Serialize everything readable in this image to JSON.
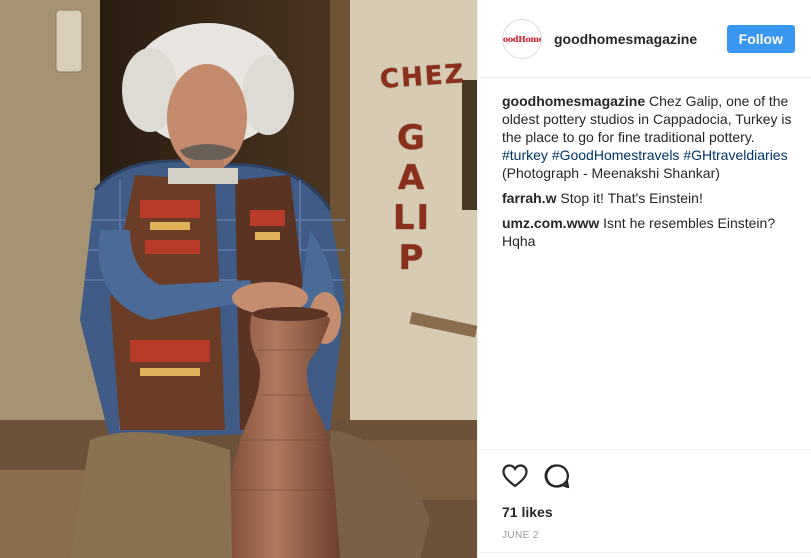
{
  "post": {
    "image_alt": "Man shaping a clay pot on a pottery wheel",
    "wall_text_1": "CHEZ",
    "wall_text_2": "GALIP"
  },
  "header": {
    "avatar_text": "GoodHomes",
    "username": "goodhomesmagazine",
    "follow_label": "Follow"
  },
  "caption": {
    "author": "goodhomesmagazine",
    "text": " Chez Galip, one of the oldest pottery studios in Cappadocia, Turkey is the place to go for fine traditional pottery. ",
    "hashtags": [
      "#turkey",
      "#GoodHomestravels",
      "#GHtraveldiaries"
    ],
    "credit": "(Photograph - Meenakshi Shankar)"
  },
  "comments": [
    {
      "author": "farrah.w",
      "text": " Stop it! That's Einstein!"
    },
    {
      "author": "umz.com.www",
      "text": " Isnt he resembles Einstein? Hqha"
    }
  ],
  "actions": {
    "like_icon": "heart-icon",
    "comment_icon": "comment-icon"
  },
  "likes": "71 likes",
  "date": "JUNE 2",
  "colors": {
    "follow_button": "#3897f0",
    "hashtag": "#003569",
    "brand_red": "#d6182b",
    "date": "#999999"
  }
}
